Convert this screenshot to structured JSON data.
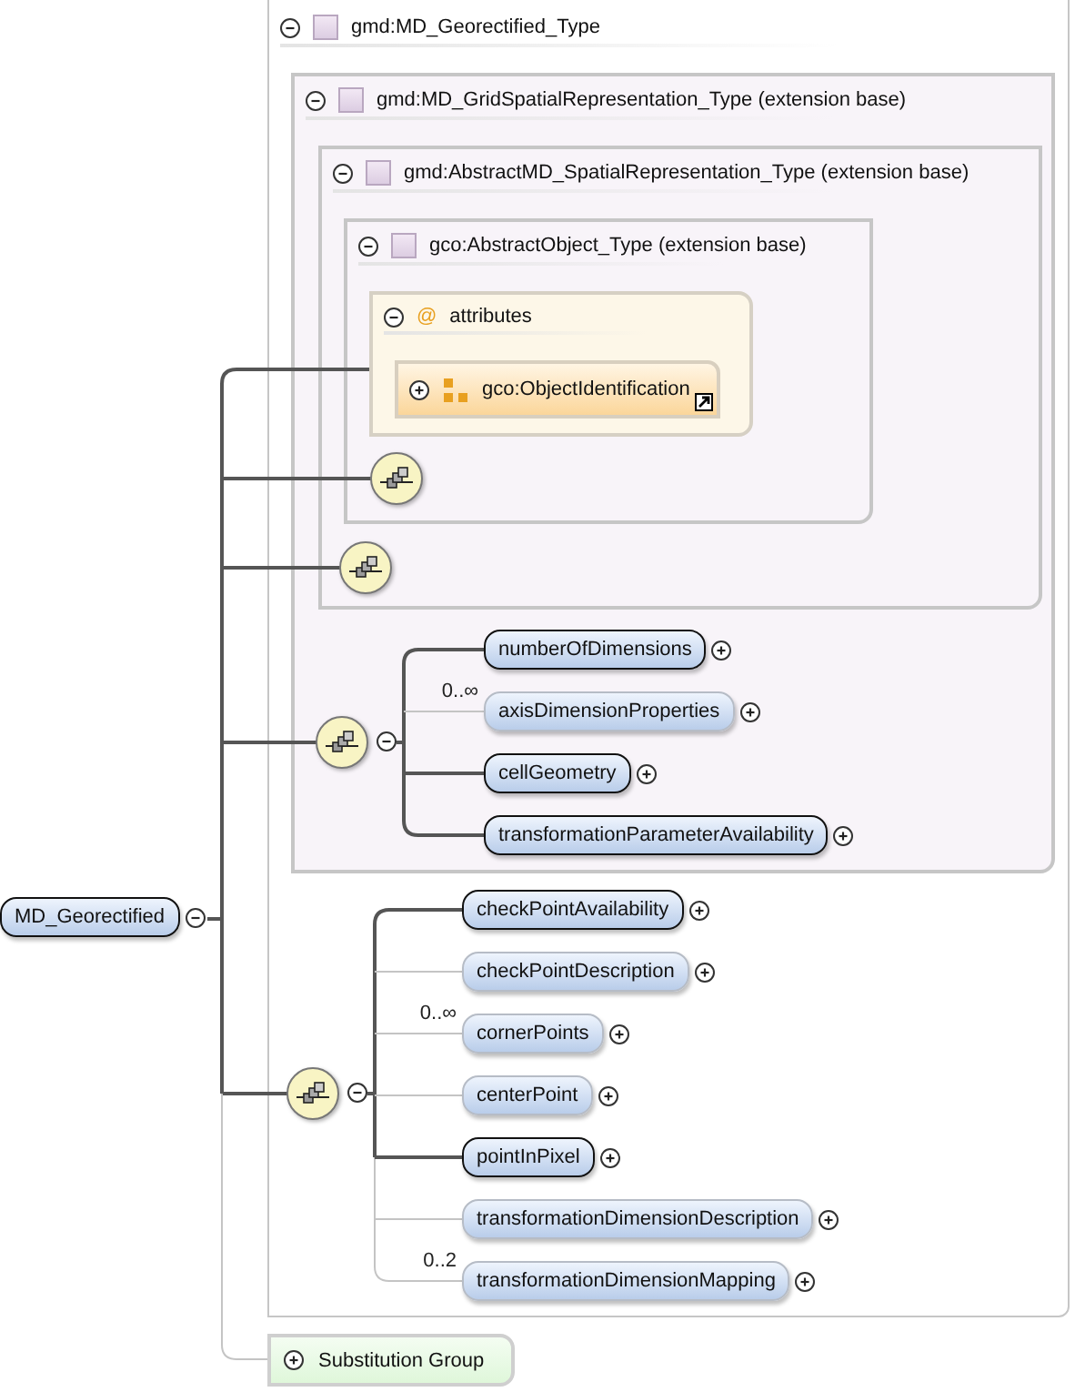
{
  "diagram_root": {
    "name": "MD_Georectified",
    "expanded": true
  },
  "type_boxes": [
    {
      "title": "gmd:MD_Georectified_Type",
      "expanded": true
    },
    {
      "title": "gmd:MD_GridSpatialRepresentation_Type (extension base)",
      "expanded": true
    },
    {
      "title": "gmd:AbstractMD_SpatialRepresentation_Type (extension base)",
      "expanded": true
    },
    {
      "title": "gco:AbstractObject_Type (extension base)",
      "expanded": true
    }
  ],
  "attributes": {
    "title": "attributes",
    "symbol": "@",
    "expanded": true,
    "items": [
      {
        "name": "gco:ObjectIdentification",
        "expanded": false
      }
    ]
  },
  "sequences": [
    {
      "kind": "empty"
    },
    {
      "kind": "empty"
    },
    {
      "kind": "group",
      "expanded": true,
      "children": [
        {
          "name": "numberOfDimensions",
          "kind": "required",
          "expanded": false
        },
        {
          "name": "axisDimensionProperties",
          "kind": "optional",
          "cardinality": "0..∞",
          "expanded": false
        },
        {
          "name": "cellGeometry",
          "kind": "required",
          "expanded": false
        },
        {
          "name": "transformationParameterAvailability",
          "kind": "required",
          "expanded": false
        }
      ]
    },
    {
      "kind": "group",
      "expanded": true,
      "children": [
        {
          "name": "checkPointAvailability",
          "kind": "required",
          "expanded": false
        },
        {
          "name": "checkPointDescription",
          "kind": "optional",
          "expanded": false
        },
        {
          "name": "cornerPoints",
          "kind": "optional",
          "cardinality": "0..∞",
          "expanded": false
        },
        {
          "name": "centerPoint",
          "kind": "optional",
          "expanded": false
        },
        {
          "name": "pointInPixel",
          "kind": "required",
          "expanded": false
        },
        {
          "name": "transformationDimensionDescription",
          "kind": "optional",
          "expanded": false
        },
        {
          "name": "transformationDimensionMapping",
          "kind": "optional",
          "cardinality": "0..2",
          "expanded": false
        }
      ]
    }
  ],
  "substitution_group": {
    "label": "Substitution Group",
    "expanded": false
  }
}
